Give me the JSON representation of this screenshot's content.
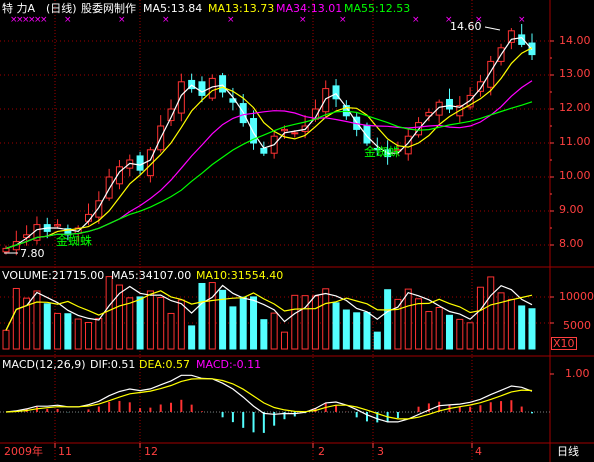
{
  "header": {
    "stock_name": "特  力A",
    "period": "(日线)",
    "producer": "股委网制作",
    "ma5": "MA5:13.84",
    "ma13": "MA13:13.73",
    "ma34": "MA34:13.01",
    "ma55": "MA55:12.53"
  },
  "price_axis": {
    "ticks": [
      "14.00",
      "13.00",
      "12.00",
      "11.00",
      "10.00",
      "9.00",
      "8.00"
    ],
    "high_label": "14.60",
    "low_label": "7.80"
  },
  "annotations": {
    "pattern_1": "金蜘蛛",
    "pattern_2": "金蜘蛛"
  },
  "volume": {
    "volume_label": "VOLUME:21715.00",
    "ma5_label": "MA5:34107.00",
    "ma10_label": "MA10:31554.40",
    "ticks": [
      "10000",
      "5000"
    ],
    "unit": "X10"
  },
  "macd": {
    "title": "MACD(12,26,9)",
    "dif": "DIF:0.51",
    "dea": "DEA:0.57",
    "macd": "MACD:-0.11",
    "tick": "1.00"
  },
  "time_axis": {
    "labels": [
      "2009年",
      "11",
      "12",
      "2",
      "3",
      "4"
    ],
    "period_button": "日线"
  },
  "colors": {
    "up": "#ff3232",
    "down": "#54ffff",
    "ma5": "#ffffff",
    "ma13": "#ffff00",
    "ma34": "#ff00ff",
    "ma55": "#00ff00",
    "grid": "#a00000"
  },
  "chart_data": {
    "type": "candlestick",
    "y_range": [
      7.8,
      14.6
    ],
    "ma_series": [
      {
        "name": "MA5",
        "last": 13.84
      },
      {
        "name": "MA13",
        "last": 13.73
      },
      {
        "name": "MA34",
        "last": 13.01
      },
      {
        "name": "MA55",
        "last": 12.53
      }
    ],
    "close_approx": [
      7.9,
      8.1,
      8.3,
      8.6,
      8.4,
      8.6,
      8.3,
      8.5,
      8.9,
      9.3,
      10.0,
      10.3,
      10.5,
      10.2,
      10.8,
      11.5,
      12.0,
      12.8,
      12.6,
      12.4,
      12.9,
      12.5,
      12.2,
      11.6,
      11.0,
      10.7,
      11.2,
      11.4,
      11.3,
      11.5,
      12.0,
      12.6,
      12.3,
      11.8,
      11.4,
      11.0,
      10.8,
      10.6,
      10.8,
      11.2,
      11.6,
      11.9,
      12.2,
      12.0,
      12.1,
      12.4,
      12.8,
      13.4,
      13.8,
      14.3,
      13.9,
      13.6
    ],
    "volume_ticks": [
      10000,
      5000
    ],
    "macd_tick": 1.0
  }
}
